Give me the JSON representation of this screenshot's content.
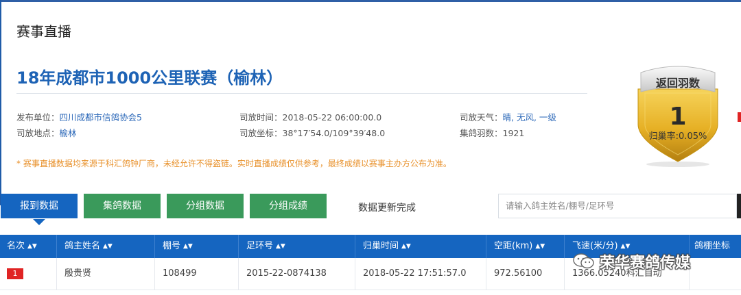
{
  "page": {
    "section_title": "赛事直播",
    "race_title": "18年成都市1000公里联赛（榆林）"
  },
  "info": {
    "publisher_label": "发布单位：",
    "publisher": "四川成都市信鸽协会5",
    "location_label": "司放地点：",
    "location": "榆林",
    "release_time_label": "司放时间：",
    "release_time": "2018-05-22 06:00:00.0",
    "coords_label": "司放坐标：",
    "coords": "38°17′54.0/109°39′48.0",
    "weather_label": "司放天气：",
    "weather": "晴, 无风, 一级",
    "birds_label": "集鸽羽数：",
    "birds": "1921"
  },
  "notice": "* 赛事直播数据均来源于科汇鸽钟厂商，未经允许不得盗链。实时直播成绩仅供参考，最终成绩以赛事主办方公布为准。",
  "medal": {
    "label": "返回羽数",
    "count": "1",
    "rate": "归巢率:0.05%"
  },
  "tabs": [
    {
      "label": "报到数据",
      "active": true
    },
    {
      "label": "集鸽数据",
      "active": false
    },
    {
      "label": "分组数据",
      "active": false
    },
    {
      "label": "分组成绩",
      "active": false
    }
  ],
  "status_text": "数据更新完成",
  "search": {
    "placeholder": "请输入鸽主姓名/棚号/足环号"
  },
  "table": {
    "columns": [
      "名次",
      "鸽主姓名",
      "棚号",
      "足环号",
      "归巢时间",
      "空距(km)",
      "飞速(米/分)",
      "鸽棚坐标"
    ],
    "rows": [
      [
        "1",
        "殷贵贤",
        "108499",
        "2015-22-0874138",
        "2018-05-22 17:51:57.0",
        "972.56100",
        "1366.05240科汇自动",
        ""
      ]
    ]
  },
  "watermark": {
    "text": "荣华赛鸽传媒",
    "icon": "wechat-icon"
  },
  "colors": {
    "primary": "#1565c0",
    "green_tab": "#3a9a5b",
    "title_blue": "#1e63b5",
    "notice_orange": "#e8912b",
    "badge_red": "#e02424",
    "medal_gold": "#e2ae22"
  }
}
